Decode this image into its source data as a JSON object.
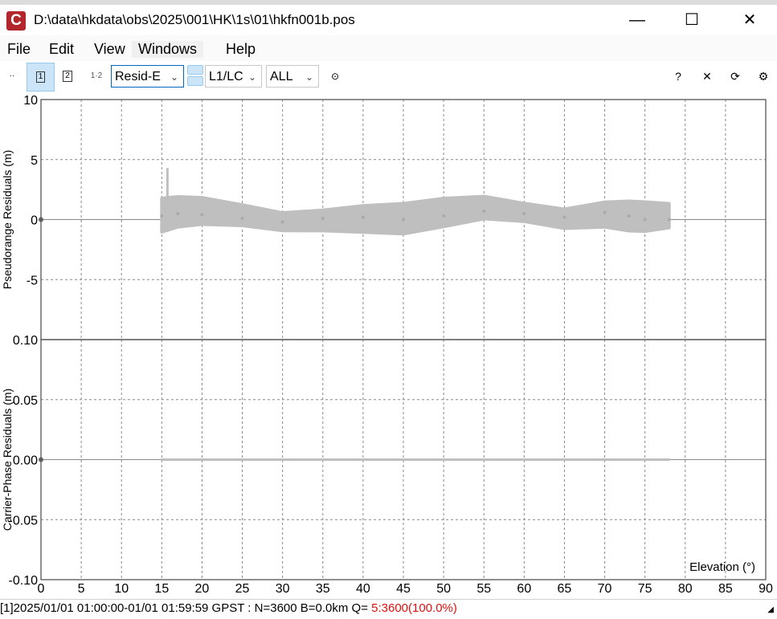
{
  "window": {
    "app_icon_letter": "C",
    "title": "D:\\data\\hkdata\\obs\\2025\\001\\HK\\1s\\01\\hkfn001b.pos",
    "minimize": "—",
    "maximize": "☐",
    "close": "✕"
  },
  "menu": [
    "File",
    "Edit",
    "View",
    "Windows",
    "Help"
  ],
  "toolbar": {
    "btn_dots": "··",
    "btn_1": "1",
    "btn_2": "2",
    "btn_12": "1·2",
    "plot_type": "Resid-E",
    "frequency": "L1/LC",
    "satellite": "ALL",
    "btn_target": "⊙",
    "help": "?",
    "close": "✕",
    "reload": "⟳",
    "settings": "⚙"
  },
  "chart_data": [
    {
      "type": "scatter",
      "ylabel": "Pseudorange Residuals (m)",
      "ylim": [
        -10,
        10
      ],
      "yticks": [
        "10",
        "5",
        "0",
        "-5",
        "0.10"
      ],
      "xlim": [
        0,
        90
      ],
      "grid": true,
      "color": "#bfbfbf",
      "x": [
        15,
        17,
        20,
        25,
        30,
        35,
        40,
        45,
        50,
        55,
        60,
        65,
        70,
        73,
        75,
        78
      ],
      "y": [
        0.3,
        0.5,
        0.4,
        0.1,
        -0.2,
        0.1,
        0.2,
        0.0,
        0.3,
        0.7,
        0.5,
        0.2,
        0.6,
        0.3,
        0.0,
        0.0
      ]
    },
    {
      "type": "scatter",
      "ylabel": "Carrier-Phase Residuals (m)",
      "ylim": [
        -0.1,
        0.1
      ],
      "yticks": [
        "0.05",
        "0.00",
        "-0.05",
        "-0.10"
      ],
      "xlim": [
        0,
        90
      ],
      "xlabel": "Elevation (°)",
      "xticks": [
        "0",
        "5",
        "10",
        "15",
        "20",
        "25",
        "30",
        "35",
        "40",
        "45",
        "50",
        "55",
        "60",
        "65",
        "70",
        "75",
        "80",
        "85",
        "90"
      ],
      "grid": true,
      "color": "#bfbfbf",
      "x": [
        15,
        20,
        30,
        40,
        50,
        60,
        70,
        78
      ],
      "y": [
        0.0,
        0.0,
        0.0,
        0.0,
        0.0,
        0.0,
        0.0,
        0.0
      ]
    }
  ],
  "status": {
    "text": "[1]2025/01/01 01:00:00-01/01 01:59:59 GPST : N=3600 B=0.0km Q= ",
    "quality": "5:3600(100.0%)"
  }
}
